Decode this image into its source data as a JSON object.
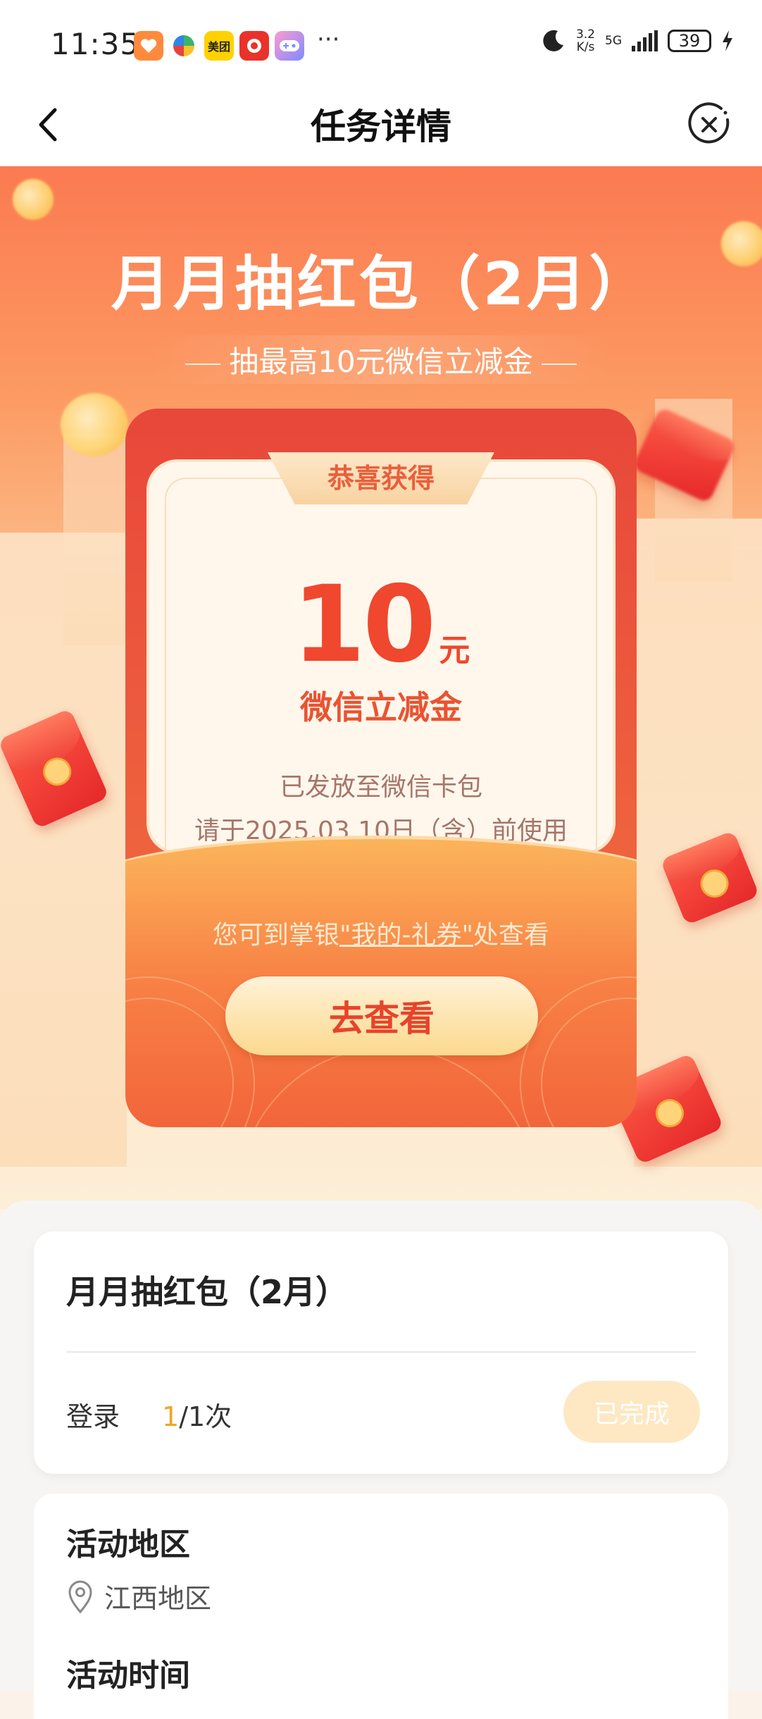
{
  "status_bar": {
    "time": "11:35",
    "apps": [
      {
        "icon": "heart-app-icon",
        "color": "#ff8a3d",
        "text": ""
      },
      {
        "icon": "pinwheel-app-icon",
        "color": "#ffffff",
        "text": ""
      },
      {
        "icon": "meituan-app-icon",
        "color": "#ffd100",
        "text": "美团"
      },
      {
        "icon": "red-app-icon",
        "color": "#e8322a",
        "text": ""
      },
      {
        "icon": "gamepad-app-icon",
        "color": "#7b8cff",
        "text": ""
      }
    ],
    "more": "···",
    "net_speed_value": "3.2",
    "net_speed_unit": "K/s",
    "network": "5G",
    "battery": "39"
  },
  "nav": {
    "title": "任务详情"
  },
  "hero": {
    "title": "月月抽红包（2月）",
    "subtitle": "抽最高10元微信立减金",
    "congrats": "恭喜获得",
    "amount": "10",
    "amount_unit": "元",
    "amount_desc": "微信立减金",
    "sent_text": "已发放至微信卡包",
    "use_text": "请于2025.03.10日（含）前使用",
    "hint_prefix": "您可到掌银",
    "hint_link": "\"我的-礼券\"",
    "hint_suffix": "处查看",
    "button": "去查看"
  },
  "task": {
    "title": "月月抽红包（2月）",
    "label": "登录",
    "done_count": "1",
    "total": "/1次",
    "status_button": "已完成"
  },
  "info": {
    "region_heading": "活动地区",
    "region": "江西地区",
    "time_heading": "活动时间"
  },
  "colors": {
    "accent_red": "#f0472f",
    "done_orange": "#f0a52a",
    "done_btn_bg": "#fde8c3"
  }
}
